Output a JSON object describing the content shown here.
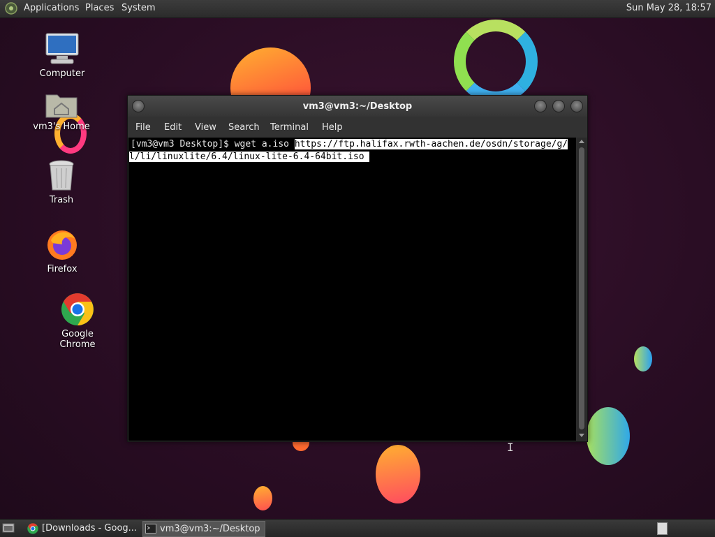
{
  "top_panel": {
    "menus": [
      "Applications",
      "Places",
      "System"
    ],
    "clock": "Sun May 28, 18:57"
  },
  "desktop_icons": [
    {
      "label": "Computer",
      "icon": "computer-icon"
    },
    {
      "label": "vm3's Home",
      "icon": "home-folder-icon"
    },
    {
      "label": "Trash",
      "icon": "trash-icon"
    },
    {
      "label": "Firefox",
      "icon": "firefox-icon"
    },
    {
      "label": "Google Chrome",
      "icon": "chrome-icon"
    }
  ],
  "terminal": {
    "title": "vm3@vm3:~/Desktop",
    "menu": [
      "File",
      "Edit",
      "View",
      "Search",
      "Terminal",
      "Help"
    ],
    "prompt": "[vm3@vm3 Desktop]$ wget a.iso ",
    "selected_line1": "https://ftp.halifax.rwth-aachen.de/osdn/storage/g/",
    "selected_line2": "l/li/linuxlite/6.4/linux-lite-6.4-64bit.iso "
  },
  "taskbar": {
    "tasks": [
      {
        "label": "[Downloads - Goog...",
        "icon": "chrome-icon",
        "active": false
      },
      {
        "label": "vm3@vm3:~/Desktop",
        "icon": "terminal-icon",
        "active": true
      }
    ]
  },
  "colors": {
    "wallpaper": "#2a0d24",
    "selection": "#ffffff",
    "terminal_bg": "#000000"
  }
}
